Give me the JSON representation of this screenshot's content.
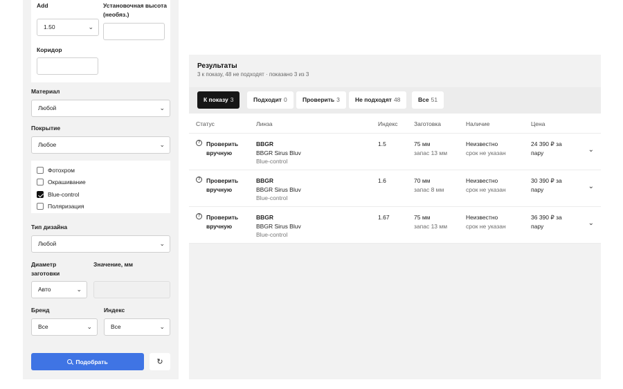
{
  "filters": {
    "add_label": "Add",
    "add_value": "1.50",
    "height_label": "Установочная высота (необяз.)",
    "height_value": "",
    "corridor_label": "Коридор",
    "corridor_value": "",
    "material_label": "Материал",
    "material_value": "Любой",
    "coating_label": "Покрытие",
    "coating_value": "Любое",
    "options": [
      {
        "label": "Фотохром",
        "checked": false
      },
      {
        "label": "Окрашивание",
        "checked": false
      },
      {
        "label": "Blue-control",
        "checked": true
      },
      {
        "label": "Поляризация",
        "checked": false
      }
    ],
    "design_label": "Тип дизайна",
    "design_value": "Любой",
    "diameter_label": "Диаметр заготовки",
    "diameter_value": "Авто",
    "value_mm_label": "Значение, мм",
    "value_mm_value": "",
    "brand_label": "Бренд",
    "brand_value": "Все",
    "index_label": "Индекс",
    "index_value": "Все",
    "submit_label": "Подобрать",
    "reset_icon": "reset-icon"
  },
  "results": {
    "title": "Результаты",
    "summary": "3 к показу, 48 не подходят · показано 3 из 3",
    "tabs": [
      {
        "label": "К показу",
        "count": "3",
        "active": true
      },
      {
        "label": "Подходит",
        "count": "0",
        "active": false
      },
      {
        "label": "Проверить",
        "count": "3",
        "active": false
      },
      {
        "label": "Не подходят",
        "count": "48",
        "active": false
      },
      {
        "label": "Все",
        "count": "51",
        "active": false
      }
    ],
    "columns": [
      "Статус",
      "Линза",
      "Индекс",
      "Заготовка",
      "Наличие",
      "Цена"
    ],
    "rows": [
      {
        "status": "Проверить вручную",
        "brand": "BBGR",
        "lens": "BBGR Sirus Bluv",
        "coating": "Blue-control",
        "index": "1.5",
        "blank": "75 мм",
        "reserve": "запас 13 мм",
        "availability": "Неизвестно",
        "term": "срок не указан",
        "price": "24 390 ₽ за пару"
      },
      {
        "status": "Проверить вручную",
        "brand": "BBGR",
        "lens": "BBGR Sirus Bluv",
        "coating": "Blue-control",
        "index": "1.6",
        "blank": "70 мм",
        "reserve": "запас 8 мм",
        "availability": "Неизвестно",
        "term": "срок не указан",
        "price": "30 390 ₽ за пару"
      },
      {
        "status": "Проверить вручную",
        "brand": "BBGR",
        "lens": "BBGR Sirus Bluv",
        "coating": "Blue-control",
        "index": "1.67",
        "blank": "75 мм",
        "reserve": "запас 13 мм",
        "availability": "Неизвестно",
        "term": "срок не указан",
        "price": "36 390 ₽ за пару"
      }
    ]
  },
  "colors": {
    "primary": "#3f74e4",
    "panel": "#f2f2f2",
    "active_tab": "#161616"
  }
}
